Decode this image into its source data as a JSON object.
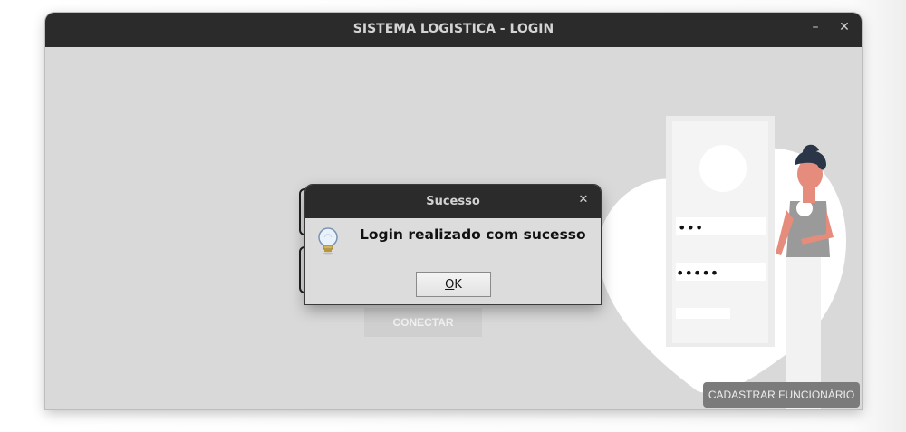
{
  "window": {
    "title": "SISTEMA LOGISTICA - LOGIN",
    "minimize_glyph": "–",
    "close_glyph": "✕"
  },
  "login": {
    "connect_label": "CONECTAR",
    "register_label": "CADASTRAR FUNCIONÁRIO",
    "illustration_username_mask": "•••",
    "illustration_password_mask": "•••••"
  },
  "dialog": {
    "title": "Sucesso",
    "close_glyph": "✕",
    "message": "Login realizado com sucesso",
    "ok_mnemonic": "O",
    "ok_rest": "K",
    "icon": "lightbulb-info-icon"
  },
  "colors": {
    "titlebar": "#2b2b2b",
    "window_bg": "#d9d9d9",
    "register_button": "#7b7b7b"
  }
}
